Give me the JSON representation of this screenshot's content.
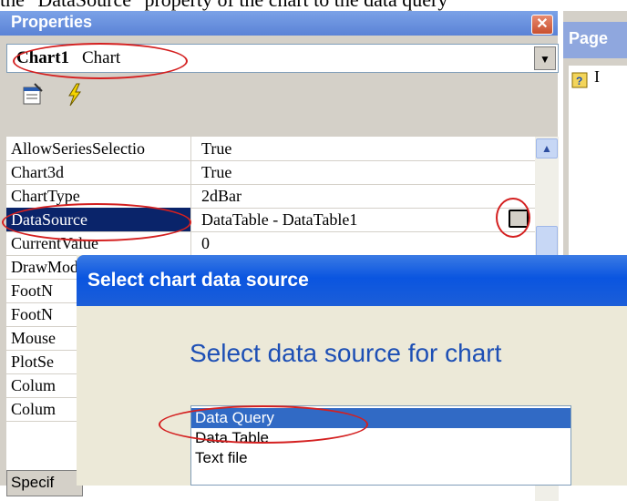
{
  "caption_text": "the \"DataSource\" property of the chart to the data query",
  "properties": {
    "title": "Properties",
    "object_name": "Chart1",
    "object_type": "Chart",
    "rows": [
      {
        "name": "AllowSeriesSelectio",
        "value": "True"
      },
      {
        "name": "Chart3d",
        "value": "True"
      },
      {
        "name": "ChartType",
        "value": "2dBar"
      },
      {
        "name": "DataSource",
        "value": "DataTable - DataTable1"
      },
      {
        "name": "CurrentValue",
        "value": "0"
      },
      {
        "name": "DrawMode",
        "value": ""
      },
      {
        "name": "FootN",
        "value": ""
      },
      {
        "name": "FootN",
        "value": ""
      },
      {
        "name": "Mouse",
        "value": ""
      },
      {
        "name": "PlotSe",
        "value": ""
      },
      {
        "name": "Colum",
        "value": ""
      },
      {
        "name": "Colum",
        "value": ""
      }
    ],
    "status_text": "Specif"
  },
  "page_panel": {
    "title": "Page",
    "item_text": "I"
  },
  "dialog": {
    "title": "Select chart data source",
    "heading": "Select data source for chart",
    "options": [
      "Data Query",
      "Data Table",
      "Text file"
    ],
    "selected_option": "Data Query"
  },
  "colors": {
    "xp_title_blue": "#0a55e0",
    "selection_navy": "#0a246a",
    "list_selection": "#316ac5",
    "annotation_red": "#d42020",
    "heading_blue": "#1d4fb5"
  }
}
